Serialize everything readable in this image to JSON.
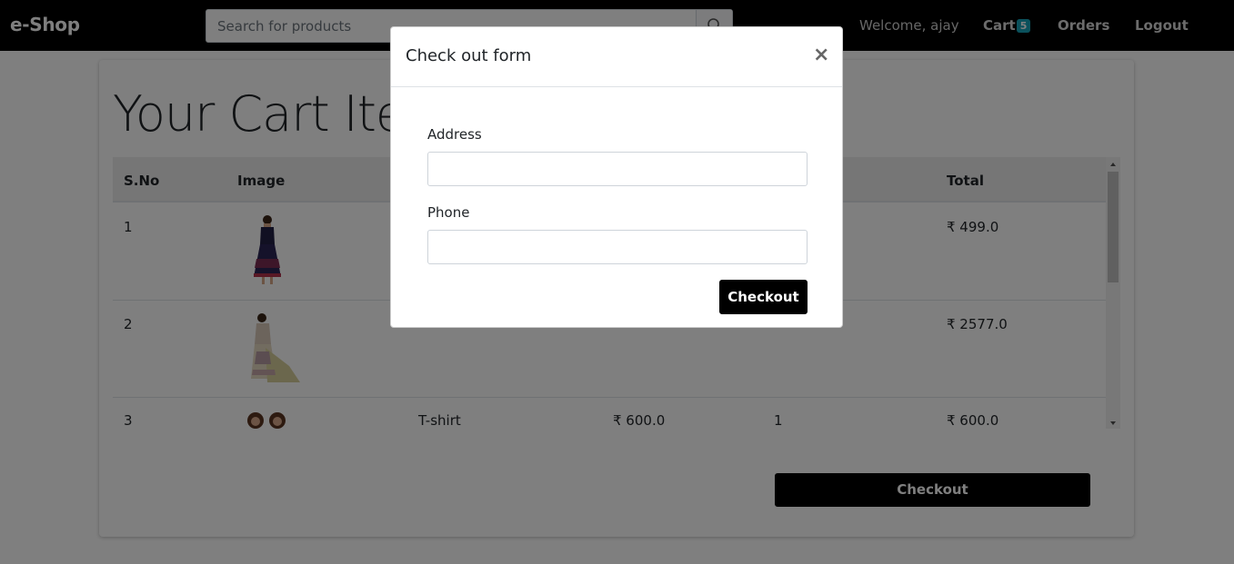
{
  "navbar": {
    "brand": "e-Shop",
    "search_placeholder": "Search for products",
    "search_icon": "search-icon",
    "welcome": "Welcome, ajay",
    "cart_label": "Cart",
    "cart_count": "5",
    "orders": "Orders",
    "logout": "Logout"
  },
  "page": {
    "title": "Your Cart Items"
  },
  "table": {
    "headers": {
      "sno": "S.No",
      "image": "Image",
      "total": "Total"
    },
    "rows": [
      {
        "sno": "1",
        "image": "dress-purple",
        "name": "",
        "price": "",
        "qty": "",
        "total": "₹ 499.0"
      },
      {
        "sno": "2",
        "image": "saree-cream",
        "name": "",
        "price": "",
        "qty": "",
        "total": "₹ 2577.0"
      },
      {
        "sno": "3",
        "image": "tshirt-couple",
        "name": "T-shirt",
        "price": "₹ 600.0",
        "qty": "1",
        "total": "₹ 600.0"
      }
    ]
  },
  "main_checkout_label": "Checkout",
  "modal": {
    "title": "Check out form",
    "close": "×",
    "address_label": "Address",
    "address_value": "",
    "phone_label": "Phone",
    "phone_value": "",
    "checkout_label": "Checkout"
  },
  "colors": {
    "navbar": "#000000",
    "badge": "#17a2b8",
    "button": "#000000"
  }
}
